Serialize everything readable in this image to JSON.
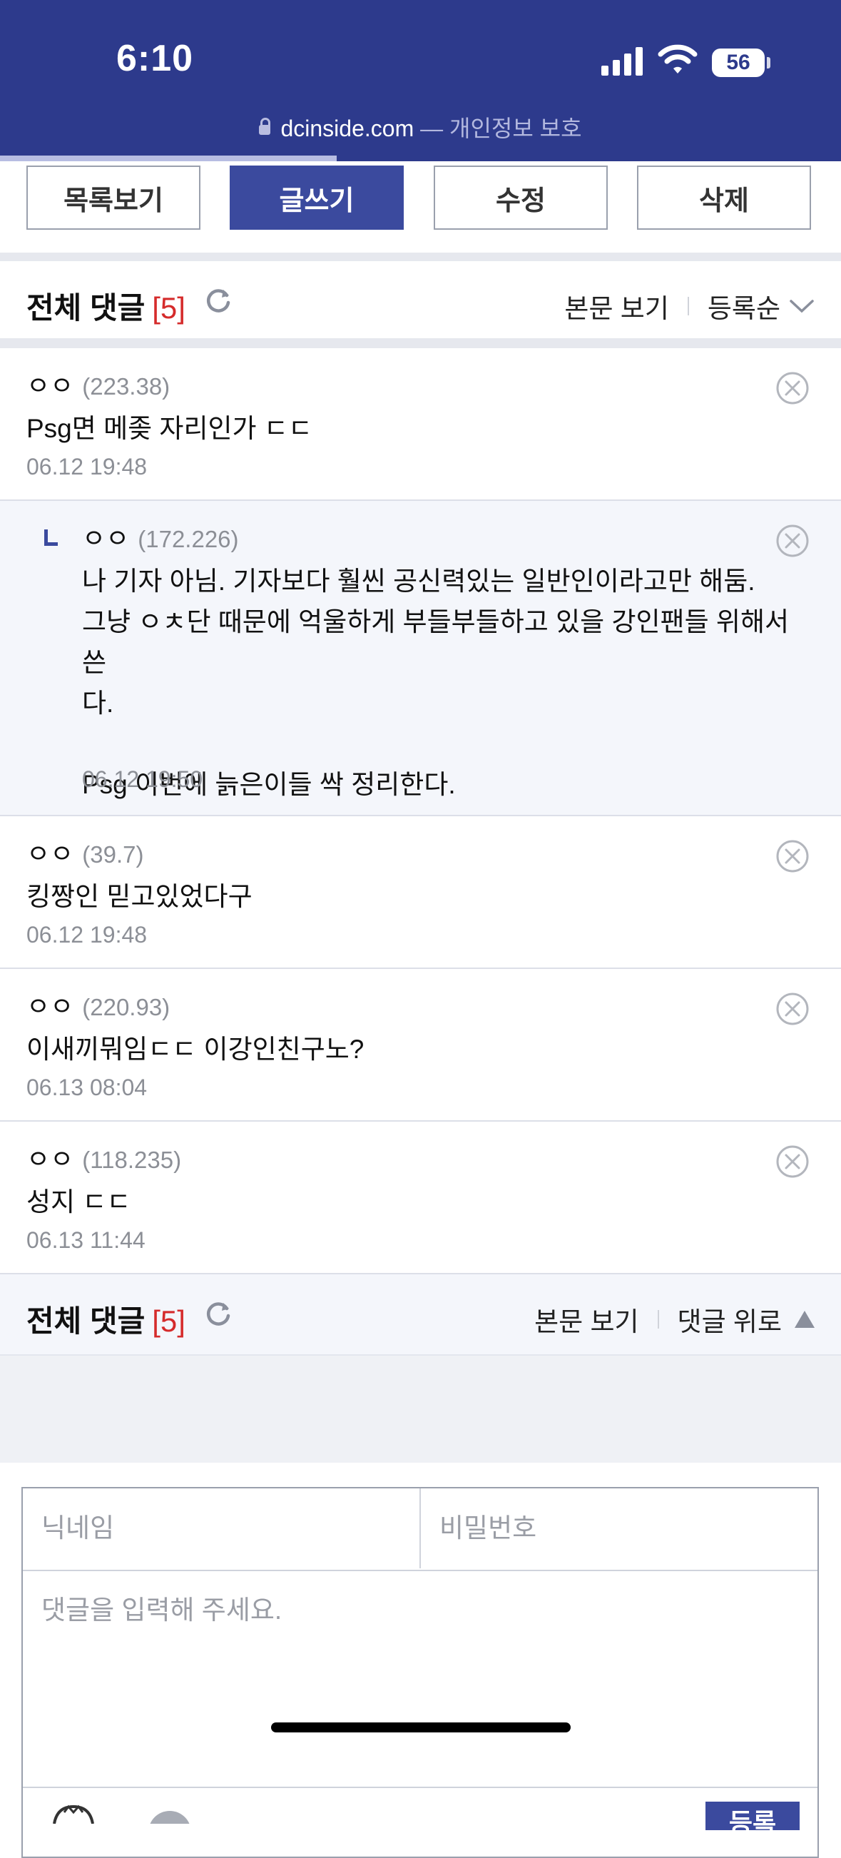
{
  "status_bar": {
    "time": "6:10",
    "battery": "56"
  },
  "url_bar": {
    "domain": "dcinside.com",
    "privacy_text": "— 개인정보 보호"
  },
  "actions": {
    "list": "목록보기",
    "write": "글쓰기",
    "edit": "수정",
    "delete": "삭제"
  },
  "comments_header": {
    "title": "전체 댓글",
    "count": "[5]",
    "view_body": "본문 보기",
    "sort": "등록순"
  },
  "comments": [
    {
      "author": "ㅇㅇ",
      "ip": "(223.38)",
      "text": "Psg면 메좆 자리인가 ㄷㄷ",
      "date": "06.12 19:48",
      "is_reply": false
    },
    {
      "author": "ㅇㅇ",
      "ip": "(172.226)",
      "text": "나 기자 아님. 기자보다 훨씬 공신력있는 일반인이라고만 해둠.\n그냥 ㅇㅊ단 때문에 억울하게 부들부들하고 있을 강인팬들 위해서 쓴\n다.\n\nPsg 이번에 늙은이들 싹 정리한다.",
      "date": "06.12 19:50",
      "is_reply": true
    },
    {
      "author": "ㅇㅇ",
      "ip": "(39.7)",
      "text": "킹짱인 믿고있었다구",
      "date": "06.12 19:48",
      "is_reply": false
    },
    {
      "author": "ㅇㅇ",
      "ip": "(220.93)",
      "text": "이새끼뭐임ㄷㄷ 이강인친구노?",
      "date": "06.13 08:04",
      "is_reply": false
    },
    {
      "author": "ㅇㅇ",
      "ip": "(118.235)",
      "text": "성지 ㄷㄷ",
      "date": "06.13 11:44",
      "is_reply": false
    }
  ],
  "comments_footer": {
    "title": "전체 댓글",
    "count": "[5]",
    "view_body": "본문 보기",
    "to_top": "댓글 위로"
  },
  "form": {
    "nickname_placeholder": "닉네임",
    "password_placeholder": "비밀번호",
    "comment_placeholder": "댓글을 입력해 주세요.",
    "submit": "등록"
  },
  "colors": {
    "brand": "#2d3a8c",
    "button": "#3b4a9e",
    "count_red": "#d52b2b"
  }
}
